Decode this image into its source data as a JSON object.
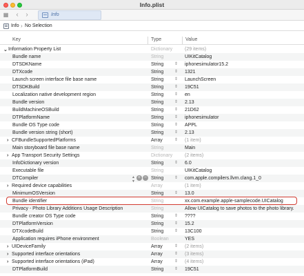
{
  "window": {
    "title": "Info.plist"
  },
  "tab": {
    "label": "Info"
  },
  "breadcrumb": {
    "items": [
      "Info",
      "No Selection"
    ]
  },
  "columns": {
    "key": "Key",
    "type": "Type",
    "value": "Value"
  },
  "highlight_color": "#d23a2f",
  "rows": [
    {
      "key": "Information Property List",
      "type": "Dictionary",
      "value": "(29 items)",
      "depth": 0,
      "disclosure": "open",
      "dimType": true,
      "dimValue": true
    },
    {
      "key": "Bundle name",
      "type": "String",
      "value": "UIKitCatalog",
      "depth": 1,
      "dimType": true
    },
    {
      "key": "DTSDKName",
      "type": "String",
      "value": "iphonesimulator15.2",
      "depth": 1
    },
    {
      "key": "DTXcode",
      "type": "String",
      "value": "1321",
      "depth": 1
    },
    {
      "key": "Launch screen interface file base name",
      "type": "String",
      "value": "LaunchScreen",
      "depth": 1
    },
    {
      "key": "DTSDKBuild",
      "type": "String",
      "value": "19C51",
      "depth": 1
    },
    {
      "key": "Localization native development region",
      "type": "String",
      "value": "en",
      "depth": 1
    },
    {
      "key": "Bundle version",
      "type": "String",
      "value": "2.13",
      "depth": 1
    },
    {
      "key": "BuildMachineOSBuild",
      "type": "String",
      "value": "21D62",
      "depth": 1
    },
    {
      "key": "DTPlatformName",
      "type": "String",
      "value": "iphonesimulator",
      "depth": 1
    },
    {
      "key": "Bundle OS Type code",
      "type": "String",
      "value": "APPL",
      "depth": 1
    },
    {
      "key": "Bundle version string (short)",
      "type": "String",
      "value": "2.13",
      "depth": 1
    },
    {
      "key": "CFBundleSupportedPlatforms",
      "type": "Array",
      "value": "(1 item)",
      "depth": 1,
      "disclosure": "closed",
      "dimValue": true
    },
    {
      "key": "Main storyboard file base name",
      "type": "String",
      "value": "Main",
      "depth": 1,
      "dimType": true
    },
    {
      "key": "App Transport Security Settings",
      "type": "Dictionary",
      "value": "(2 items)",
      "depth": 1,
      "disclosure": "closed",
      "dimType": true,
      "dimValue": true
    },
    {
      "key": "InfoDictionary version",
      "type": "String",
      "value": "6.0",
      "depth": 1
    },
    {
      "key": "Executable file",
      "type": "String",
      "value": "UIKitCatalog",
      "depth": 1,
      "dimType": true
    },
    {
      "key": "DTCompiler",
      "type": "String",
      "value": "com.apple.compilers.llvm.clang.1_0",
      "depth": 1,
      "controls": true
    },
    {
      "key": "Required device capabilities",
      "type": "Array",
      "value": "(1 item)",
      "depth": 1,
      "disclosure": "closed",
      "dimType": true,
      "dimValue": true
    },
    {
      "key": "MinimumOSVersion",
      "type": "String",
      "value": "13.0",
      "depth": 1
    },
    {
      "key": "Bundle identifier",
      "type": "String",
      "value": "xx.com.example.apple-samplecode.UICatalog",
      "depth": 1,
      "dimType": true,
      "highlighted": true
    },
    {
      "key": "Privacy - Photo Library Additions Usage Description",
      "type": "String",
      "value": "Allow UICatalog to save photos to the photo library.",
      "depth": 1,
      "dimType": true
    },
    {
      "key": "Bundle creator OS Type code",
      "type": "String",
      "value": "????",
      "depth": 1
    },
    {
      "key": "DTPlatformVersion",
      "type": "String",
      "value": "15.2",
      "depth": 1
    },
    {
      "key": "DTXcodeBuild",
      "type": "String",
      "value": "13C100",
      "depth": 1
    },
    {
      "key": "Application requires iPhone environment",
      "type": "Boolean",
      "value": "YES",
      "depth": 1,
      "dimType": true
    },
    {
      "key": "UIDeviceFamily",
      "type": "Array",
      "value": "(2 items)",
      "depth": 1,
      "disclosure": "closed",
      "dimValue": true
    },
    {
      "key": "Supported interface orientations",
      "type": "Array",
      "value": "(3 items)",
      "depth": 1,
      "disclosure": "closed",
      "dimValue": true
    },
    {
      "key": "Supported interface orientations (iPad)",
      "type": "Array",
      "value": "(4 items)",
      "depth": 1,
      "disclosure": "closed",
      "dimValue": true
    },
    {
      "key": "DTPlatformBuild",
      "type": "String",
      "value": "19C51",
      "depth": 1
    }
  ]
}
